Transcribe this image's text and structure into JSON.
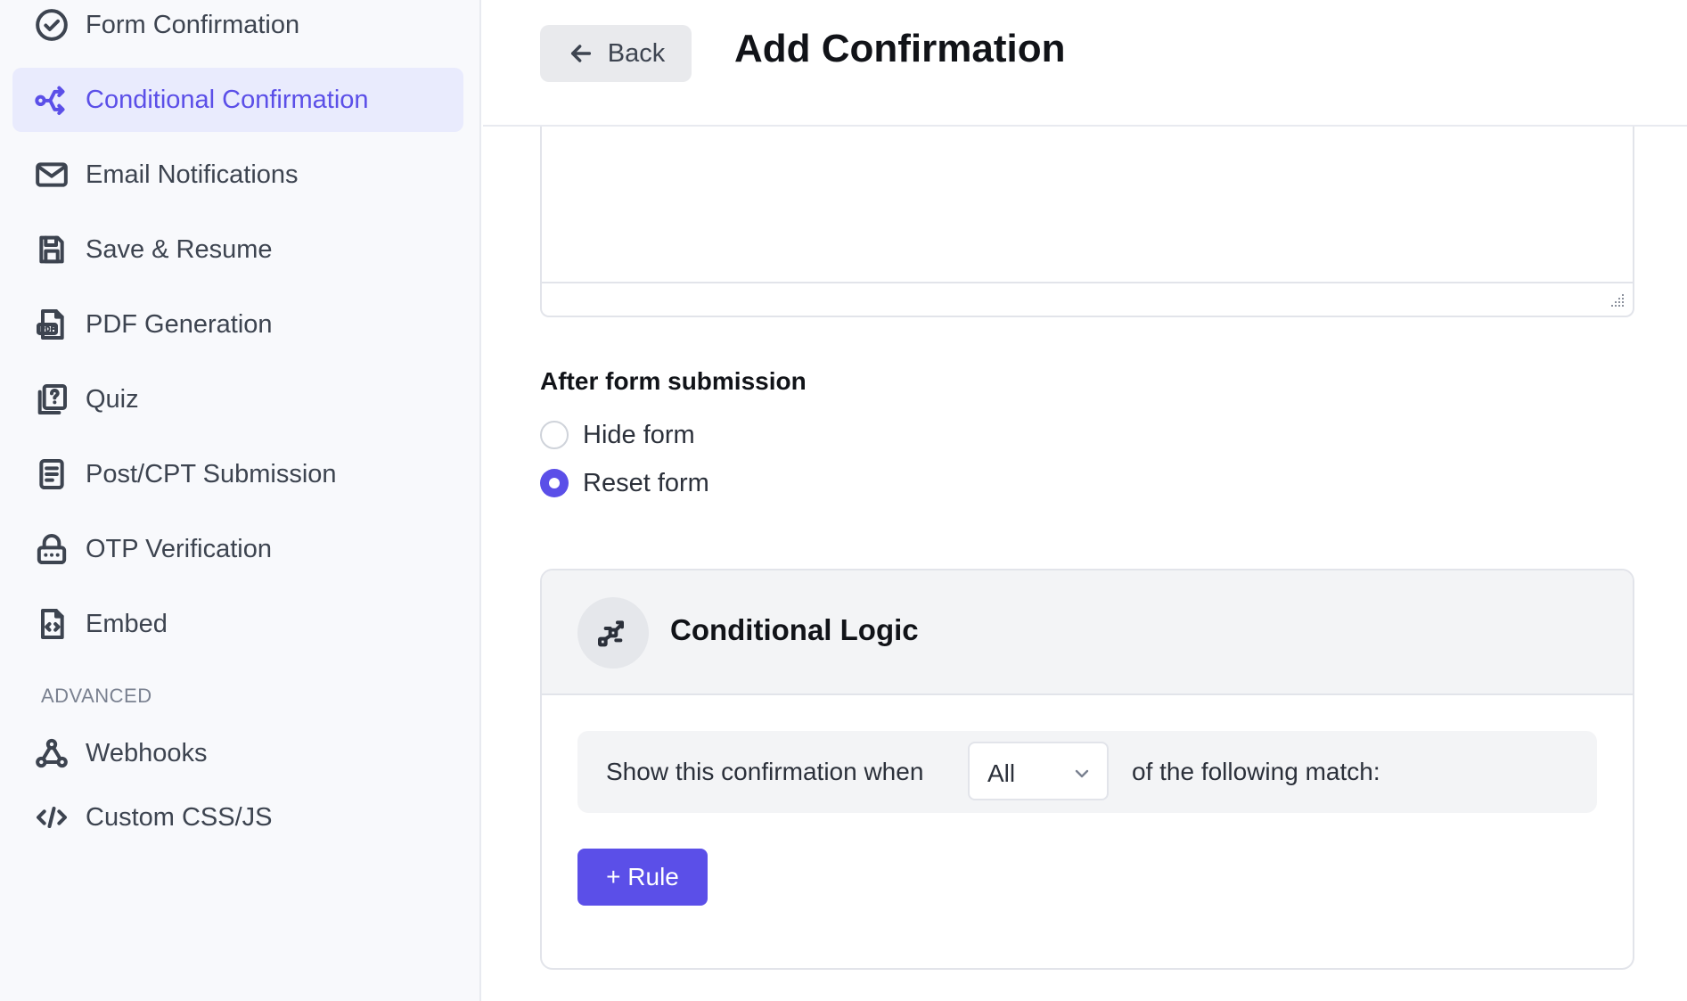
{
  "colors": {
    "accent": "#5b4fe8",
    "active_bg": "#e9ebfd",
    "sidebar_bg": "#f8f9fc"
  },
  "sidebar": {
    "items": [
      {
        "label": "Form Confirmation",
        "icon": "check-circle-icon",
        "active": false
      },
      {
        "label": "Conditional Confirmation",
        "icon": "branch-icon",
        "active": true
      },
      {
        "label": "Email Notifications",
        "icon": "envelope-icon",
        "active": false
      },
      {
        "label": "Save & Resume",
        "icon": "save-icon",
        "active": false
      },
      {
        "label": "PDF Generation",
        "icon": "pdf-file-icon",
        "active": false
      },
      {
        "label": "Quiz",
        "icon": "quiz-icon",
        "active": false
      },
      {
        "label": "Post/CPT Submission",
        "icon": "document-icon",
        "active": false
      },
      {
        "label": "OTP Verification",
        "icon": "lock-icon",
        "active": false
      },
      {
        "label": "Embed",
        "icon": "code-file-icon",
        "active": false
      }
    ],
    "advanced_label": "ADVANCED",
    "advanced_items": [
      {
        "label": "Webhooks",
        "icon": "webhook-icon"
      },
      {
        "label": "Custom CSS/JS",
        "icon": "code-icon"
      }
    ]
  },
  "header": {
    "back_label": "Back",
    "title": "Add Confirmation"
  },
  "after_submission": {
    "label": "After form submission",
    "options": [
      {
        "label": "Hide form",
        "checked": false
      },
      {
        "label": "Reset form",
        "checked": true
      }
    ]
  },
  "conditional_logic": {
    "title": "Conditional Logic",
    "prefix": "Show this confirmation when",
    "match_value": "All",
    "suffix": "of the following match:",
    "add_rule_label": "+ Rule"
  }
}
